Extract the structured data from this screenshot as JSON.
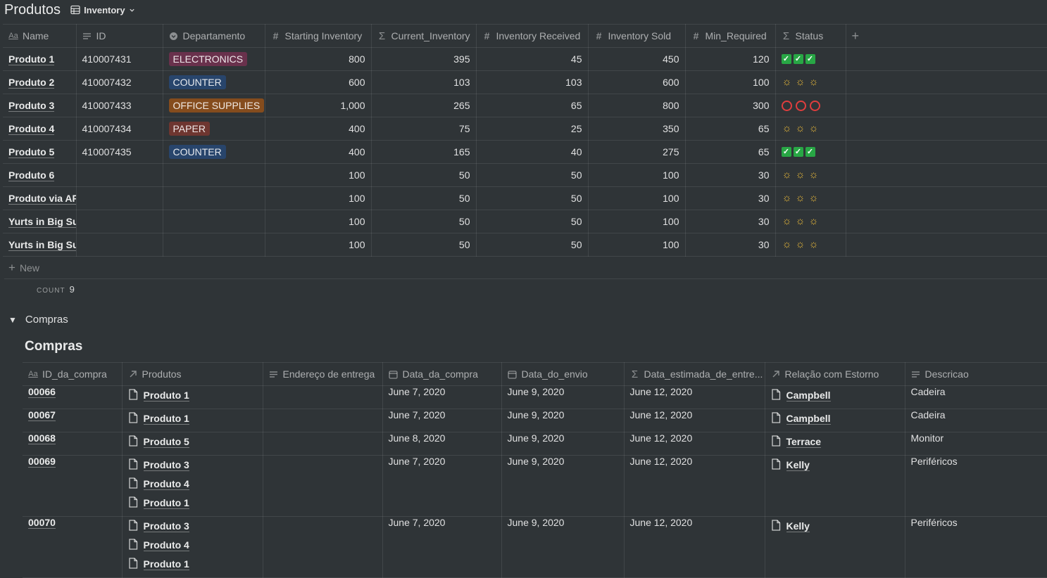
{
  "page": {
    "title": "Produtos",
    "view_name": "Inventory"
  },
  "inventory": {
    "columns": [
      {
        "label": "Name",
        "icon": "title-property-icon"
      },
      {
        "label": "ID",
        "icon": "text-property-icon"
      },
      {
        "label": "Departamento",
        "icon": "select-property-icon"
      },
      {
        "label": "Starting Inventory",
        "icon": "number-property-icon"
      },
      {
        "label": "Current_Inventory",
        "icon": "formula-property-icon"
      },
      {
        "label": "Inventory Received",
        "icon": "number-property-icon"
      },
      {
        "label": "Inventory Sold",
        "icon": "number-property-icon"
      },
      {
        "label": "Min_Required",
        "icon": "number-property-icon"
      },
      {
        "label": "Status",
        "icon": "formula-property-icon"
      }
    ],
    "rows": [
      {
        "name": "Produto 1",
        "id": "410007431",
        "dept": "ELECTRONICS",
        "dept_color": "#69314c",
        "start": "800",
        "current": "395",
        "received": "45",
        "sold": "450",
        "min": "120",
        "status": "check"
      },
      {
        "name": "Produto 2",
        "id": "410007432",
        "dept": "COUNTER",
        "dept_color": "#28456c",
        "start": "600",
        "current": "103",
        "received": "103",
        "sold": "600",
        "min": "100",
        "status": "sun"
      },
      {
        "name": "Produto 3",
        "id": "410007433",
        "dept": "OFFICE SUPPLIES",
        "dept_color": "#854c1d",
        "start": "1,000",
        "current": "265",
        "received": "65",
        "sold": "800",
        "min": "300",
        "status": "circle"
      },
      {
        "name": "Produto 4",
        "id": "410007434",
        "dept": "PAPER",
        "dept_color": "#6e3630",
        "start": "400",
        "current": "75",
        "received": "25",
        "sold": "350",
        "min": "65",
        "status": "sun"
      },
      {
        "name": "Produto 5",
        "id": "410007435",
        "dept": "COUNTER",
        "dept_color": "#28456c",
        "start": "400",
        "current": "165",
        "received": "40",
        "sold": "275",
        "min": "65",
        "status": "check"
      },
      {
        "name": "Produto 6",
        "id": "",
        "dept": "",
        "dept_color": "",
        "start": "100",
        "current": "50",
        "received": "50",
        "sold": "100",
        "min": "30",
        "status": "sun"
      },
      {
        "name": "Produto via API",
        "id": "",
        "dept": "",
        "dept_color": "",
        "start": "100",
        "current": "50",
        "received": "50",
        "sold": "100",
        "min": "30",
        "status": "sun"
      },
      {
        "name": "Yurts in Big Sur",
        "id": "",
        "dept": "",
        "dept_color": "",
        "start": "100",
        "current": "50",
        "received": "50",
        "sold": "100",
        "min": "30",
        "status": "sun"
      },
      {
        "name": "Yurts in Big Sur",
        "id": "",
        "dept": "",
        "dept_color": "",
        "start": "100",
        "current": "50",
        "received": "50",
        "sold": "100",
        "min": "30",
        "status": "sun"
      }
    ],
    "new_label": "New",
    "count_label": "COUNT",
    "count_value": "9",
    "status_colors": {
      "check": "#28a745",
      "sun": "#e6b73a",
      "circle": "#e03e3e"
    }
  },
  "compras_toggle": {
    "label": "Compras"
  },
  "compras": {
    "title": "Compras",
    "columns": [
      {
        "label": "ID_da_compra",
        "icon": "title-property-icon"
      },
      {
        "label": "Produtos",
        "icon": "relation-property-icon"
      },
      {
        "label": "Endereço de entrega",
        "icon": "text-property-icon"
      },
      {
        "label": "Data_da_compra",
        "icon": "date-property-icon"
      },
      {
        "label": "Data_do_envio",
        "icon": "date-property-icon"
      },
      {
        "label": "Data_estimada_de_entre...",
        "icon": "formula-property-icon"
      },
      {
        "label": "Relação com Estorno",
        "icon": "relation-property-icon"
      },
      {
        "label": "Descricao",
        "icon": "text-property-icon"
      }
    ],
    "rows": [
      {
        "id": "00066",
        "produtos": [
          "Produto 1"
        ],
        "endereco": "",
        "compra": "June 7, 2020",
        "envio": "June 9, 2020",
        "estimada": "June 12, 2020",
        "estorno": "Campbell",
        "descricao": "Cadeira"
      },
      {
        "id": "00067",
        "produtos": [
          "Produto 1"
        ],
        "endereco": "",
        "compra": "June 7, 2020",
        "envio": "June 9, 2020",
        "estimada": "June 12, 2020",
        "estorno": "Campbell",
        "descricao": "Cadeira"
      },
      {
        "id": "00068",
        "produtos": [
          "Produto 5"
        ],
        "endereco": "",
        "compra": "June 8, 2020",
        "envio": "June 9, 2020",
        "estimada": "June 12, 2020",
        "estorno": "Terrace",
        "descricao": "Monitor"
      },
      {
        "id": "00069",
        "produtos": [
          "Produto 3",
          "Produto 4",
          "Produto 1"
        ],
        "endereco": "",
        "compra": "June 7, 2020",
        "envio": "June 9, 2020",
        "estimada": "June 12, 2020",
        "estorno": "Kelly",
        "descricao": "Periféricos"
      },
      {
        "id": "00070",
        "produtos": [
          "Produto 3",
          "Produto 4",
          "Produto 1"
        ],
        "endereco": "",
        "compra": "June 7, 2020",
        "envio": "June 9, 2020",
        "estimada": "June 12, 2020",
        "estorno": "Kelly",
        "descricao": "Periféricos"
      }
    ]
  }
}
